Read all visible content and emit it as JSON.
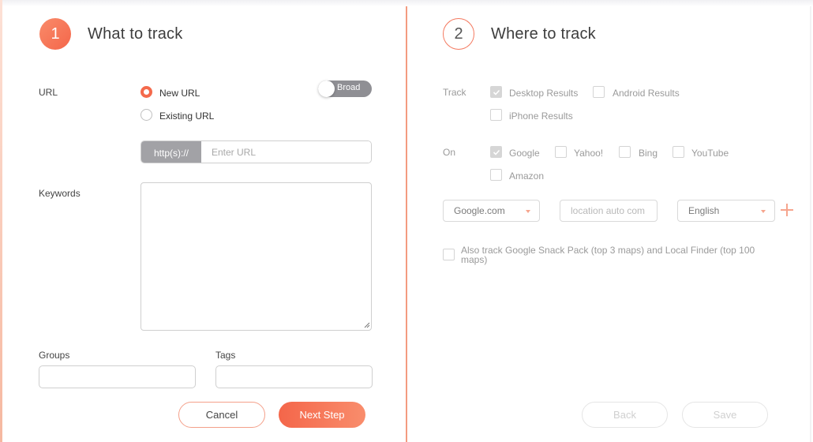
{
  "step1": {
    "number": "1",
    "title": "What to track",
    "url_label": "URL",
    "url_options": [
      "New URL",
      "Existing URL"
    ],
    "selected_url_option": "New URL",
    "match_toggle_label": "Broad",
    "url_prefix": "http(s)://",
    "url_placeholder": "Enter URL",
    "keywords_label": "Keywords",
    "groups_label": "Groups",
    "tags_label": "Tags",
    "cancel_label": "Cancel",
    "next_label": "Next Step"
  },
  "step2": {
    "number": "2",
    "title": "Where to track",
    "track_label": "Track",
    "track_options": [
      {
        "label": "Desktop Results",
        "checked": true
      },
      {
        "label": "Android Results",
        "checked": false
      },
      {
        "label": "iPhone Results",
        "checked": false
      }
    ],
    "on_label": "On",
    "engine_options": [
      {
        "label": "Google",
        "checked": true
      },
      {
        "label": "Yahoo!",
        "checked": false
      },
      {
        "label": "Bing",
        "checked": false
      },
      {
        "label": "YouTube",
        "checked": false
      },
      {
        "label": "Amazon",
        "checked": false
      }
    ],
    "domain_select": "Google.com",
    "location_placeholder": "location auto com",
    "language_select": "English",
    "snack_pack_label": "Also track Google Snack Pack (top 3 maps) and Local Finder (top 100 maps)",
    "snack_pack_checked": false,
    "back_label": "Back",
    "save_label": "Save"
  },
  "colors": {
    "accent": "#f4664a",
    "accent_light": "#f98d6c",
    "divider": "#f39b80",
    "muted_text": "#9a9a9a",
    "toggle_bg": "#8f8f94"
  },
  "icons": [
    "check-icon",
    "caret-down-icon",
    "plus-icon",
    "resize-grip-icon"
  ]
}
